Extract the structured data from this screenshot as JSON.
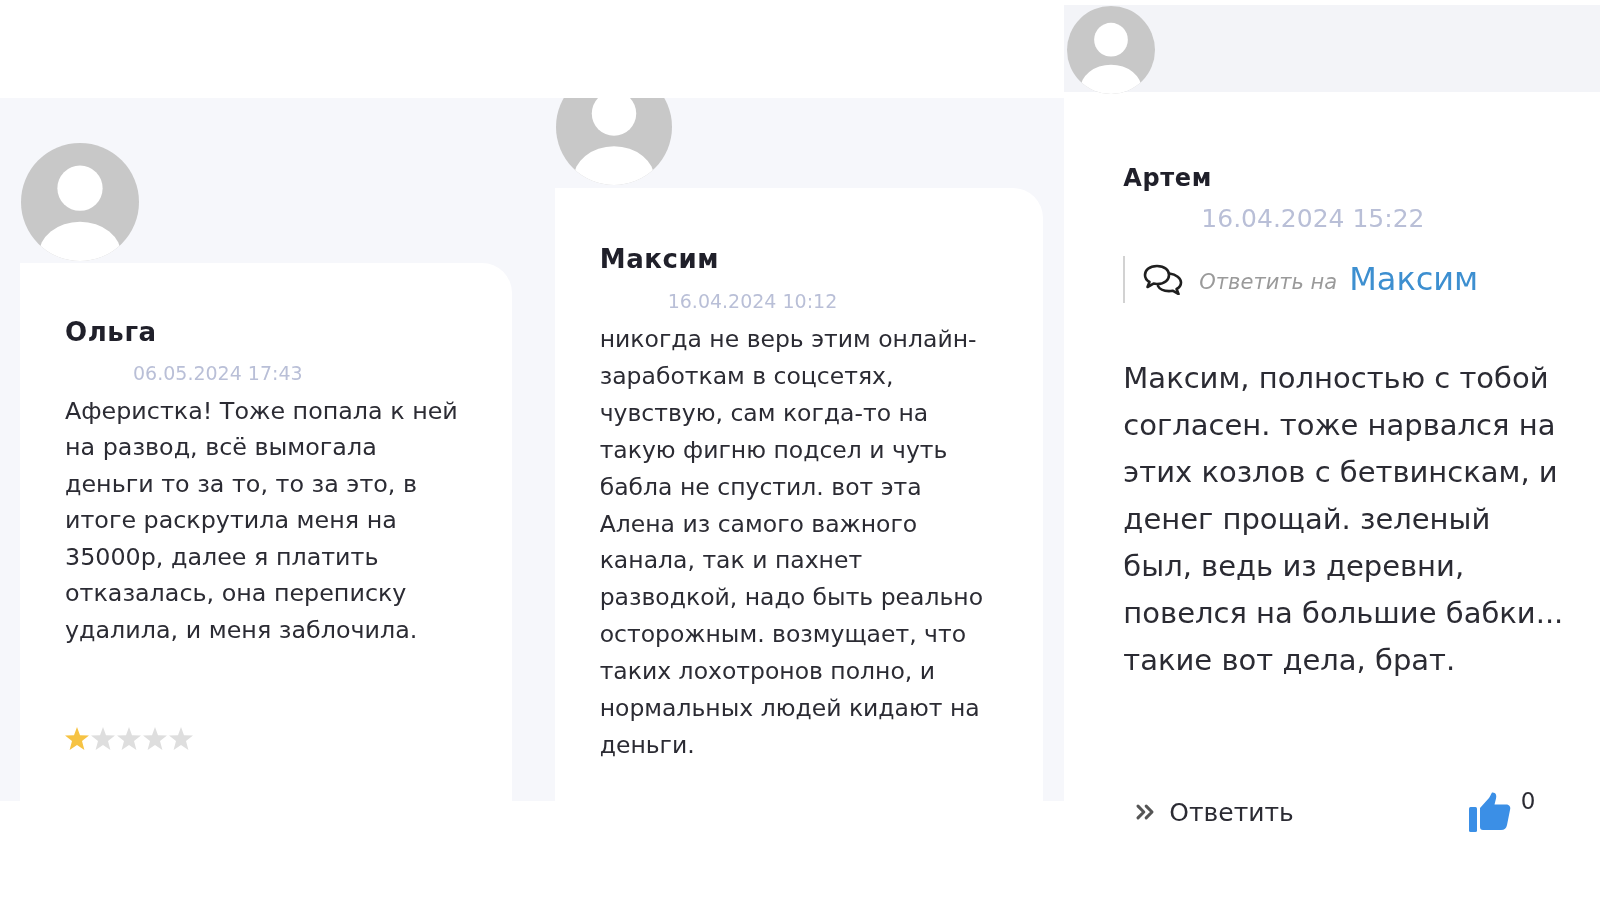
{
  "panels": [
    {
      "kind": "review",
      "author": "Ольга",
      "date": "06.05.2024 17:43",
      "text": "Аферистка! Тоже попала к ней\nна развод, всё вымогала\nденьги то за то, то за это, в\nитоге раскрутила меня на\n35000р, далее я платить\nотказалась, она переписку\nудалила, и меня заблочила.",
      "stars": 1
    },
    {
      "kind": "review",
      "author": "Максим",
      "date": "16.04.2024 10:12",
      "text": "никогда не верь этим онлайн-\nзаработкам в соцсетях,\nчувствую, сам когда-то на\nтакую фигню подсел и чуть\nбабла не спустил. вот эта\nАлена из самого важного\nканала, так и пахнет\nразводкой, надо быть реально\nосторожным. возмущает, что\nтаких лохотронов полно, и\nнормальных людей кидают на\nденьги."
    },
    {
      "kind": "reply",
      "author": "Артем",
      "date": "16.04.2024 15:22",
      "reply_to": {
        "label": "Ответить на",
        "name": "Максим"
      },
      "text": "Максим, полностью с тобой\nсогласен. тоже нарвался на\nэтих козлов с бетвинскам, и\nденег прощай. зеленый\nбыл, ведь из деревни,\nповелся на большие бабки...\nтакие вот дела, брат.",
      "reply_button": "Ответить",
      "likes": "0"
    }
  ]
}
